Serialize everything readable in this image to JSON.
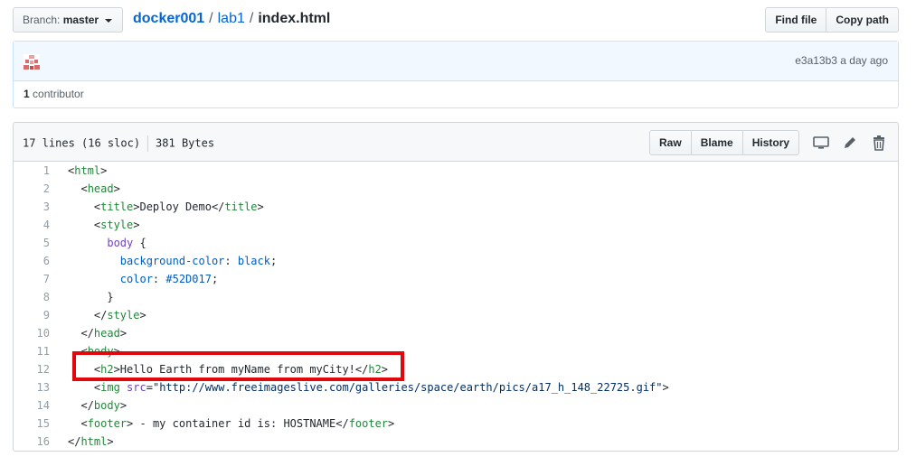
{
  "branch": {
    "label": "Branch:",
    "value": "master"
  },
  "breadcrumb": {
    "repo": "docker001",
    "dir": "lab1",
    "file": "index.html",
    "sep": "/"
  },
  "header_buttons": {
    "find_file": "Find file",
    "copy_path": "Copy path"
  },
  "commit": {
    "hash": "e3a13b3",
    "time": "a day ago"
  },
  "contributors": {
    "count": "1",
    "label": "contributor"
  },
  "file": {
    "lines": "17 lines (16 sloc)",
    "size": "381 Bytes",
    "buttons": {
      "raw": "Raw",
      "blame": "Blame",
      "history": "History"
    },
    "icons": [
      "desktop-icon",
      "pencil-icon",
      "trash-icon"
    ]
  },
  "code_lines": [
    {
      "n": "1",
      "t": "<html>"
    },
    {
      "n": "2",
      "t": "  <head>"
    },
    {
      "n": "3",
      "t": "    <title>Deploy Demo</title>"
    },
    {
      "n": "4",
      "t": "    <style>"
    },
    {
      "n": "5",
      "t": "      body {"
    },
    {
      "n": "6",
      "t": "        background-color: black;"
    },
    {
      "n": "7",
      "t": "        color: #52D017;"
    },
    {
      "n": "8",
      "t": "      }"
    },
    {
      "n": "9",
      "t": "    </style>"
    },
    {
      "n": "10",
      "t": "  </head>"
    },
    {
      "n": "11",
      "t": "  <body>"
    },
    {
      "n": "12",
      "t": "    <h2>Hello Earth from myName from myCity!</h2>"
    },
    {
      "n": "13",
      "t": "    <img src=\"http://www.freeimageslive.com/galleries/space/earth/pics/a17_h_148_22725.gif\">"
    },
    {
      "n": "14",
      "t": "  </body>"
    },
    {
      "n": "15",
      "t": "  <footer> - my container id is: HOSTNAME</footer>"
    },
    {
      "n": "16",
      "t": "</html>"
    }
  ],
  "colors": {
    "link": "#0366d6",
    "highlight": "#e0070d",
    "tag": "#22863a"
  }
}
